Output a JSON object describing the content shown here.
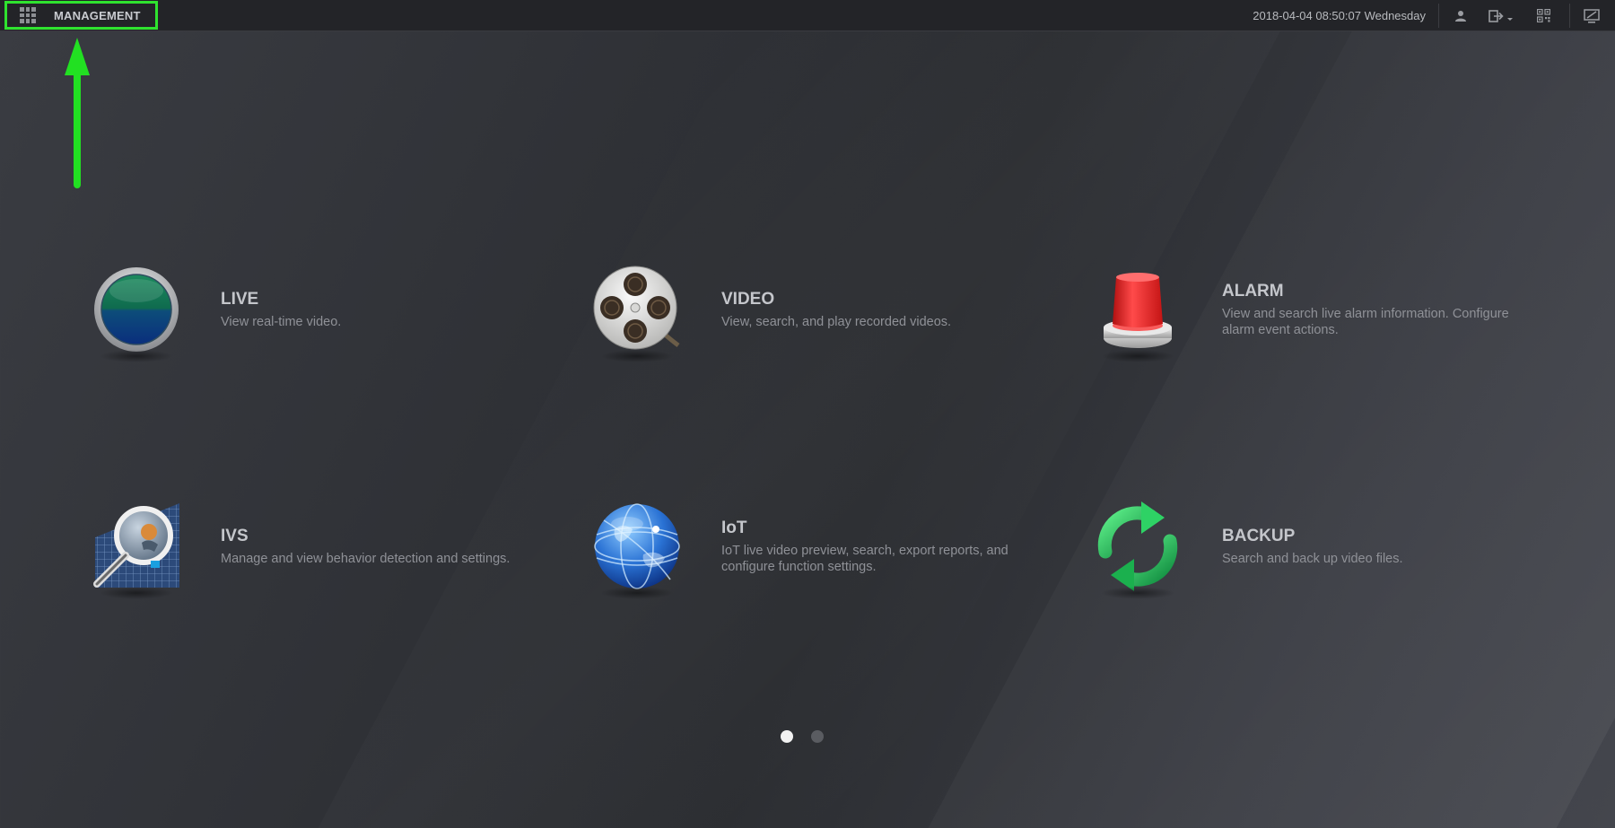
{
  "topbar": {
    "menu_label": "MANAGEMENT",
    "datetime": "2018-04-04 08:50:07 Wednesday",
    "icons": [
      "grid-icon",
      "user-icon",
      "logout-icon",
      "qr-code-icon",
      "monitor-icon"
    ]
  },
  "tiles": [
    {
      "title": "LIVE",
      "desc": "View real-time video.",
      "icon": "live-icon"
    },
    {
      "title": "VIDEO",
      "desc": "View, search, and play recorded videos.",
      "icon": "film-reel-icon"
    },
    {
      "title": "ALARM",
      "desc": "View and search live alarm information. Configure alarm event actions.",
      "icon": "alarm-siren-icon"
    },
    {
      "title": "IVS",
      "desc": "Manage and view behavior detection and settings.",
      "icon": "magnifier-icon"
    },
    {
      "title": "IoT",
      "desc": "IoT live video preview, search, export reports, and configure function settings.",
      "icon": "globe-icon"
    },
    {
      "title": "BACKUP",
      "desc": "Search and back up video files.",
      "icon": "refresh-icon"
    }
  ],
  "pager": {
    "pages": 2,
    "current": 1
  },
  "colors": {
    "highlight": "#2fe32f",
    "background": "#2f3136",
    "topbar": "#232428"
  }
}
